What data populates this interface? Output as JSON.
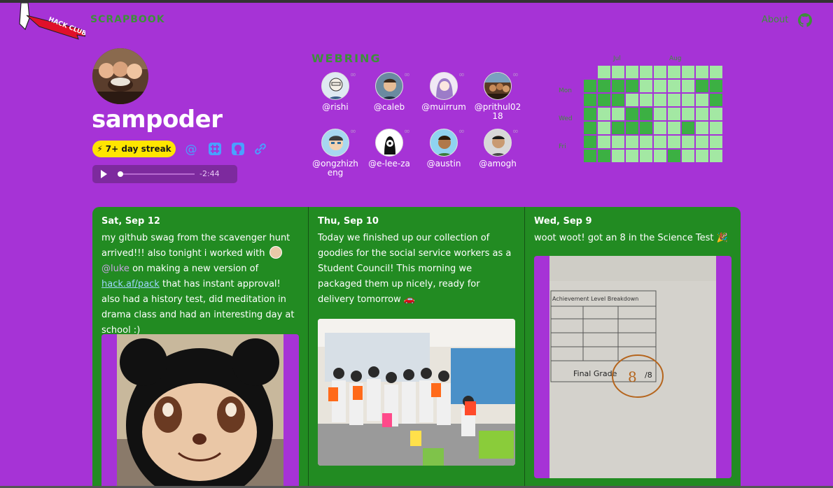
{
  "header": {
    "club_badge": "HACK CLUB",
    "brand": "SCRAPBOOK",
    "about": "About"
  },
  "profile": {
    "username": "sampoder",
    "streak": "7+ day streak",
    "audio_time": "-2:44"
  },
  "webring": {
    "title": "WEBRING",
    "members": [
      {
        "handle": "@rishi"
      },
      {
        "handle": "@caleb"
      },
      {
        "handle": "@muirrum"
      },
      {
        "handle": "@prithul02 18"
      },
      {
        "handle": "@ongzhizh eng"
      },
      {
        "handle": "@e-lee-za"
      },
      {
        "handle": "@austin"
      },
      {
        "handle": "@amogh"
      }
    ]
  },
  "heatmap": {
    "months": [
      "Jul",
      "Aug"
    ],
    "days": [
      "Mon",
      "Wed",
      "Fri"
    ],
    "colors": {
      "none": "#a3e8a3",
      "some": "#3cb043",
      "lots": "#2a9c32",
      "today": "#1f1f1f"
    }
  },
  "posts": [
    {
      "date": "Sat, Sep 12",
      "text_1": "my github swag from the scavenger hunt arrived!!! also tonight i worked with",
      "mention": "@luke",
      "text_2": "on making a new version of",
      "link": "hack.af/pack",
      "text_3": "that has instant approval! also had a history test, did meditation in drama class and had an interesting day at school :)"
    },
    {
      "date": "Thu, Sep 10",
      "text": "Today we finished up our collection of goodies for the social service workers as a Student Council! This morning we packaged them up nicely, ready for delivery tomorrow",
      "emoji": "🚗"
    },
    {
      "date": "Wed, Sep 9",
      "text": "woot woot! got an 8 in the Science Test",
      "emoji": "🎉",
      "sheet_title": "Achievement Level Breakdown",
      "sheet_final": "Final Grade",
      "sheet_grade": "8",
      "sheet_out_of": "/8"
    }
  ]
}
